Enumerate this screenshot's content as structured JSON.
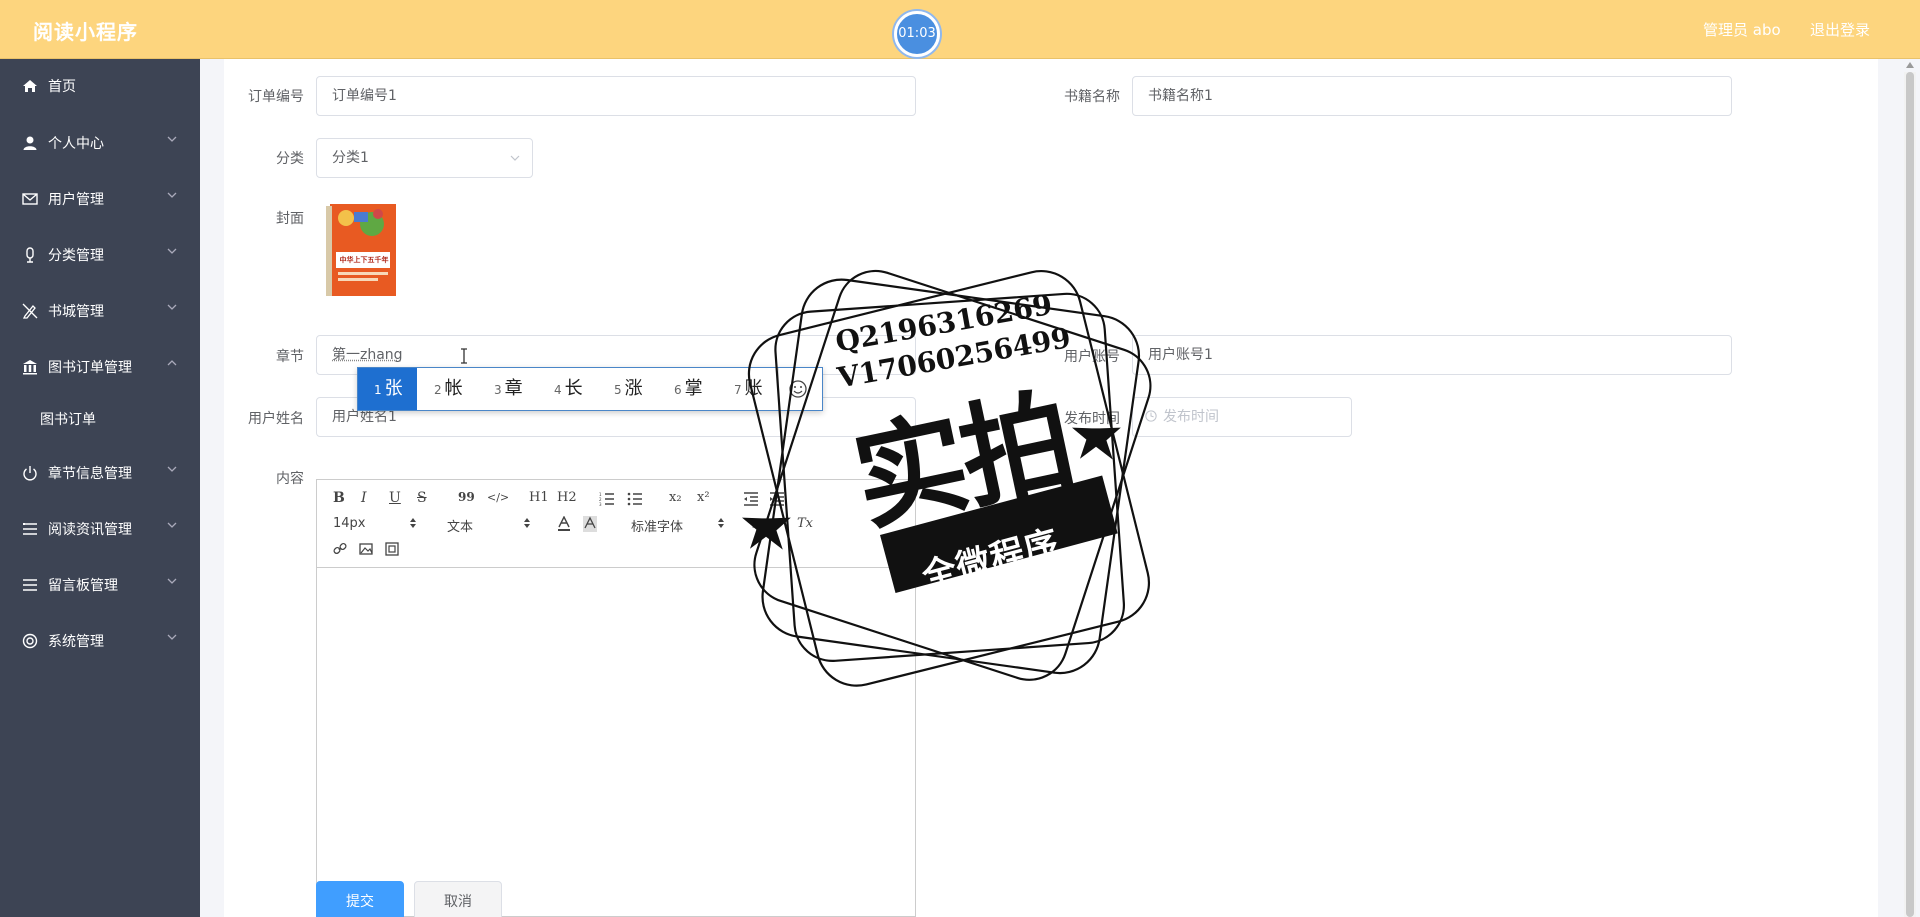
{
  "header": {
    "brand": "阅读小程序",
    "timer": "01:03",
    "admin": "管理员 abo",
    "logout": "退出登录"
  },
  "sidebar": {
    "items": [
      {
        "label": "首页",
        "icon": "home-icon"
      },
      {
        "label": "个人中心",
        "icon": "user-icon"
      },
      {
        "label": "用户管理",
        "icon": "mail-icon"
      },
      {
        "label": "分类管理",
        "icon": "microphone-icon"
      },
      {
        "label": "书城管理",
        "icon": "pencil-off-icon"
      },
      {
        "label": "图书订单管理",
        "icon": "bank-icon"
      },
      {
        "label": "图书订单",
        "icon": ""
      },
      {
        "label": "章节信息管理",
        "icon": "power-icon"
      },
      {
        "label": "阅读资讯管理",
        "icon": "list-icon"
      },
      {
        "label": "留言板管理",
        "icon": "menu-icon"
      },
      {
        "label": "系统管理",
        "icon": "settings-icon"
      }
    ]
  },
  "form": {
    "order_no_label": "订单编号",
    "order_no_value": "订单编号1",
    "book_name_label": "书籍名称",
    "book_name_value": "书籍名称1",
    "category_label": "分类",
    "category_value": "分类1",
    "cover_label": "封面",
    "cover_title": "中华上下五千年",
    "chapter_label": "章节",
    "chapter_value": "第一zhang",
    "account_label": "用户账号",
    "account_value": "用户账号1",
    "username_label": "用户姓名",
    "username_value": "用户姓名1",
    "publish_label": "发布时间",
    "publish_placeholder": "发布时间",
    "content_label": "内容",
    "submit": "提交",
    "cancel": "取消"
  },
  "editor": {
    "font_size": "14px",
    "header_select": "文本",
    "font_select": "标准字体",
    "buttons": {
      "bold": "B",
      "italic": "I",
      "underline": "U",
      "strike": "S",
      "quote": "99",
      "code": "</>",
      "h1": "H1",
      "h2": "H2",
      "sub": "x₂",
      "sup": "x²",
      "align": "≡",
      "clean": "Tx"
    }
  },
  "ime": {
    "candidates": [
      {
        "num": "1",
        "char": "张"
      },
      {
        "num": "2",
        "char": "帐"
      },
      {
        "num": "3",
        "char": "章"
      },
      {
        "num": "4",
        "char": "长"
      },
      {
        "num": "5",
        "char": "涨"
      },
      {
        "num": "6",
        "char": "掌"
      },
      {
        "num": "7",
        "char": "账"
      }
    ]
  },
  "watermark": {
    "line1": "Q2196316269",
    "line2": "V17060256499",
    "big": "实拍",
    "banner": "全微程序"
  },
  "colors": {
    "header": "#fdd57e",
    "sidebar": "#3d4454",
    "primary": "#409eff",
    "ime_active": "#1e6fd0"
  }
}
